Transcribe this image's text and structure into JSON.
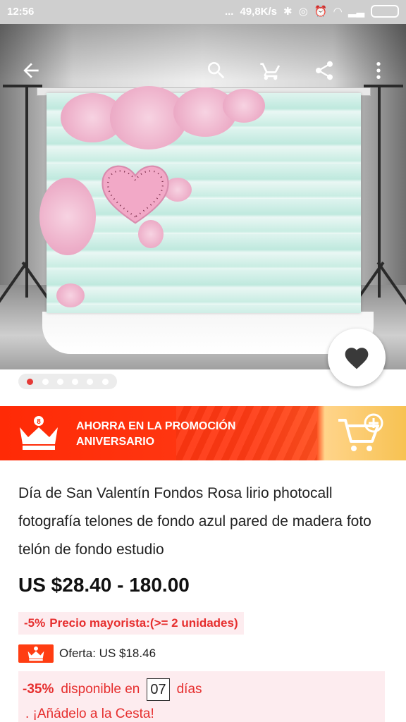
{
  "status_bar": {
    "time": "12:56",
    "dots": "...",
    "network_speed": "49,8K/s"
  },
  "toolbar": {
    "back_icon": "arrow-left-icon",
    "search_icon": "search-icon",
    "cart_icon": "cart-icon",
    "share_icon": "share-icon",
    "more_icon": "more-vertical-icon"
  },
  "gallery": {
    "page_count": 6,
    "active_index": 0
  },
  "promo": {
    "line1": "AHORRA EN LA PROMOCIÓN",
    "line2": "ANIVERSARIO"
  },
  "product": {
    "title": "Día de San Valentín Fondos Rosa lirio photocall fotografía telones de fondo azul pared de madera foto telón de fondo estudio",
    "price": "US $28.40 - 180.00",
    "wholesale_pct": "-5%",
    "wholesale_text": "Precio mayorista:(>= 2 unidades)",
    "offer_text": "Oferta: US $18.46",
    "discount_pct": "-35%",
    "discount_text": "disponible en",
    "discount_days": "07",
    "discount_days_label": "días",
    "discount_line2": ". ¡Añádelo a la Cesta!"
  },
  "colors": {
    "accent_red": "#e62e2e",
    "banner_red": "#ff2a06",
    "banner_gold": "#f7c252"
  }
}
